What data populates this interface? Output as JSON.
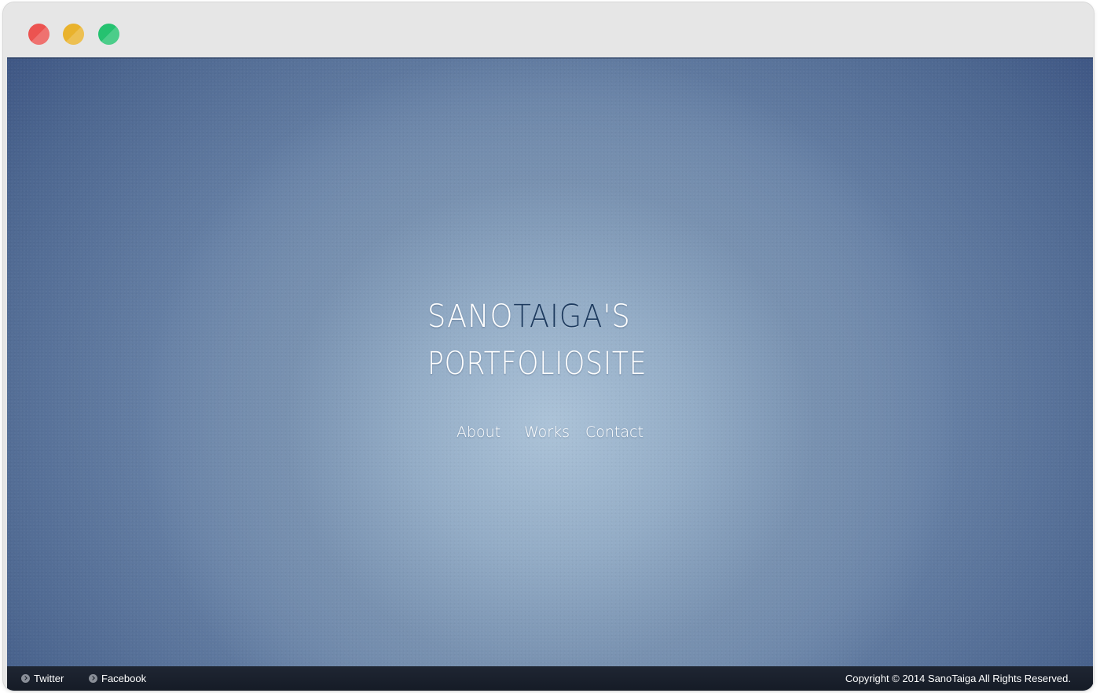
{
  "window": {
    "controls": {
      "close": "close-button",
      "minimize": "minimize-button",
      "maximize": "maximize-button"
    }
  },
  "logo": {
    "line1_first": "SANO",
    "line1_last": "TAIGA",
    "line1_apos": "'S",
    "line2": "PORTFOLIOSITE"
  },
  "nav": {
    "items": [
      {
        "label": "About"
      },
      {
        "label": "Works"
      },
      {
        "label": "Contact"
      }
    ]
  },
  "footer": {
    "links": [
      {
        "label": "Twitter",
        "icon": "chevron-circle-icon"
      },
      {
        "label": "Facebook",
        "icon": "chevron-circle-icon"
      }
    ],
    "copyright": "Copyright © 2014 SanoTaiga All Rights Reserved."
  },
  "colors": {
    "background_center": "#acc3d8",
    "background_edge": "#3e5684",
    "accent_text": "#1d3a5e",
    "footer_bg": "#1a202b",
    "close": "#ec5350",
    "minimize": "#e9b22c",
    "maximize": "#25c270"
  }
}
